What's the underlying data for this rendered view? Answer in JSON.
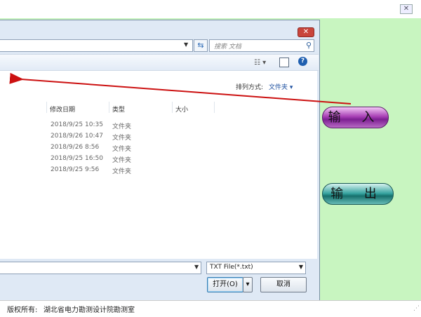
{
  "dialog": {
    "search_placeholder": "搜索 文档",
    "sort_label": "排列方式:",
    "sort_value": "文件夹 ▾",
    "columns": [
      "修改日期",
      "类型",
      "大小"
    ],
    "rows": [
      {
        "date": "2018/9/25 10:35",
        "type": "文件夹"
      },
      {
        "date": "2018/9/26 10:47",
        "type": "文件夹"
      },
      {
        "date": "2018/9/26 8:56",
        "type": "文件夹"
      },
      {
        "date": "2018/9/25 16:50",
        "type": "文件夹"
      },
      {
        "date": "2018/9/25 9:56",
        "type": "文件夹"
      }
    ],
    "file_type": "TXT File(*.txt)",
    "open_label": "打开(O)",
    "cancel_label": "取消"
  },
  "app": {
    "input_label": "输 入",
    "output_label": "输 出",
    "copyright_label": "版权所有:",
    "copyright_owner": "湖北省电力勘测设计院勘测室"
  },
  "colors": {
    "background": "#c8f5c0",
    "arrow": "#cc1111",
    "input_button": "#9b37ac",
    "output_button": "#2a8f8b"
  }
}
